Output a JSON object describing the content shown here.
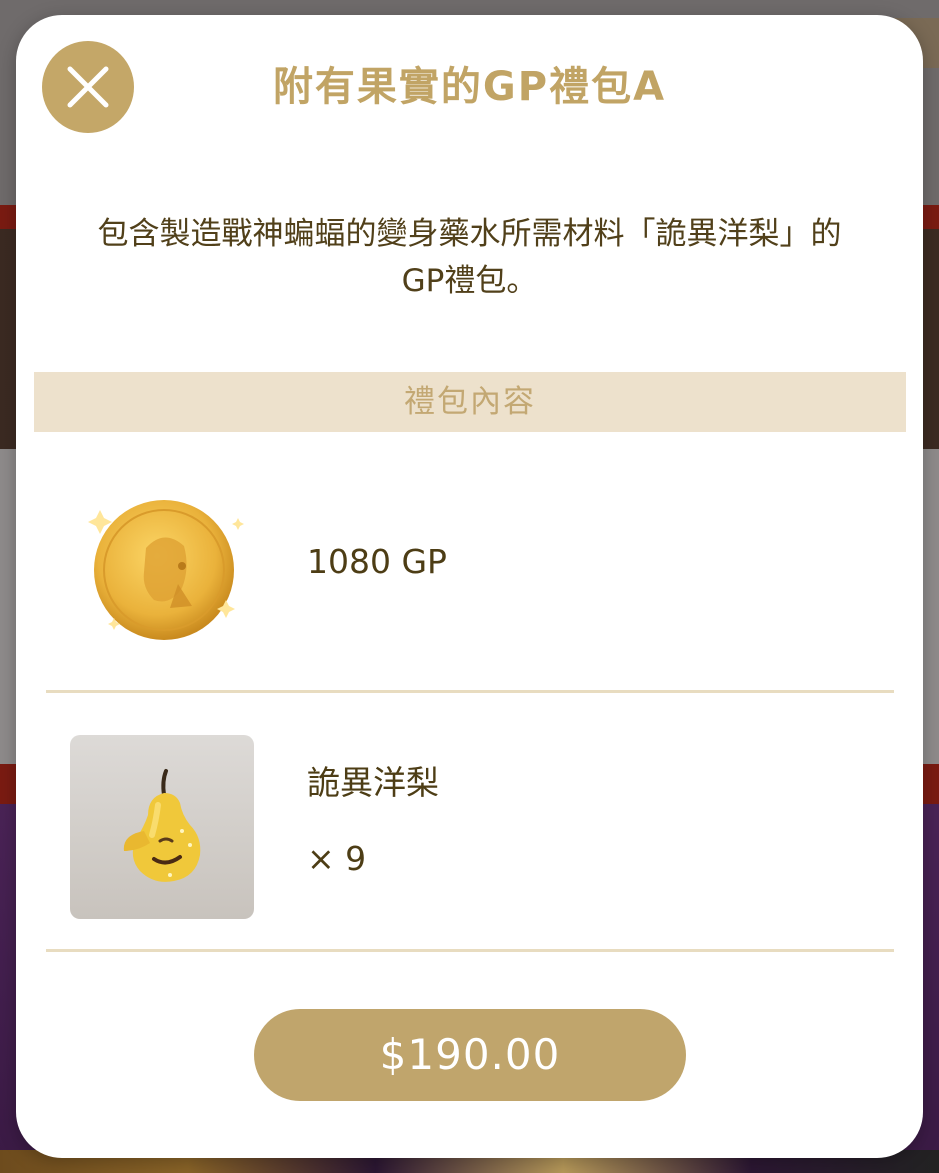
{
  "modal": {
    "title": "附有果實的GP禮包A",
    "description_line1": "包含製造戰神蝙蝠的變身藥水所需材料「詭異洋梨」的",
    "description_line2": "GP禮包。",
    "section_header": "禮包內容",
    "items": [
      {
        "name": "1080 GP",
        "icon": "gold-coin-icon"
      },
      {
        "name": "詭異洋梨",
        "quantity": "× 9",
        "icon": "pear-icon"
      }
    ],
    "price_label": "$190.00",
    "close_icon": "close-icon"
  },
  "colors": {
    "accent_gold": "#c4a768",
    "title_gold": "#c1a465",
    "text_brown": "#51401a",
    "section_bg": "#ede1cc"
  }
}
